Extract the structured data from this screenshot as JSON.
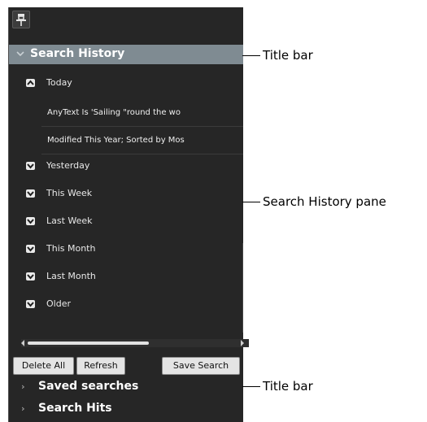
{
  "search_history": {
    "title": "Search History",
    "groups": [
      {
        "label": "Today",
        "expanded": true
      },
      {
        "label": "Yesterday",
        "expanded": false
      },
      {
        "label": "This Week",
        "expanded": false
      },
      {
        "label": "Last Week",
        "expanded": false
      },
      {
        "label": "This Month",
        "expanded": false
      },
      {
        "label": "Last Month",
        "expanded": false
      },
      {
        "label": "Older",
        "expanded": false
      }
    ],
    "today_items": [
      "AnyText Is 'Sailing \"round the wo",
      "Modified This Year; Sorted by Mos"
    ],
    "scroll_fraction": 0.55
  },
  "actions": {
    "delete_all": "Delete All",
    "refresh": "Refresh",
    "save_search": "Save Search"
  },
  "collapsed_sections": [
    "Saved searches",
    "Search Hits"
  ],
  "callouts": {
    "title_bar": "Title bar",
    "pane": "Search History pane",
    "title_bar_2": "Title bar"
  },
  "colors": {
    "panel_bg": "#262626",
    "title_bar_bg": "#7f8b92",
    "text_light": "#e8e8e8"
  },
  "icons": [
    "pushpin-icon",
    "chevron-down-icon",
    "chevron-up-icon",
    "chevron-right-icon"
  ]
}
